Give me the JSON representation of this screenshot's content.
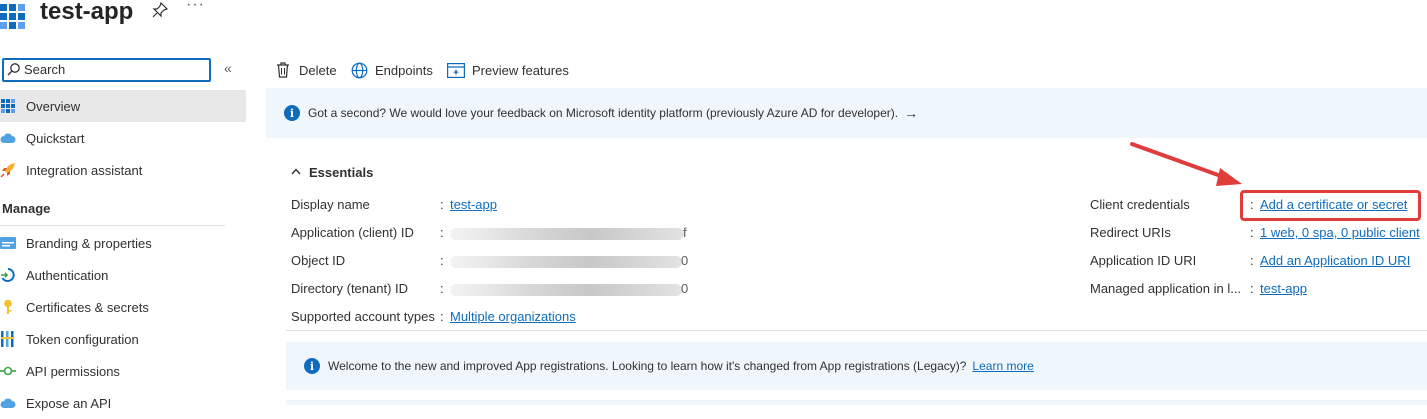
{
  "app": {
    "title": "test-app"
  },
  "sidebar": {
    "search_placeholder": "Search",
    "collapse_glyph": "«",
    "items_top": [
      {
        "label": "Overview",
        "icon": "grid-icon",
        "active": true
      },
      {
        "label": "Quickstart",
        "icon": "cloud-icon"
      },
      {
        "label": "Integration assistant",
        "icon": "rocket-icon"
      }
    ],
    "section_header": "Manage",
    "items_manage": [
      {
        "label": "Branding & properties",
        "icon": "branding-icon"
      },
      {
        "label": "Authentication",
        "icon": "authentication-icon"
      },
      {
        "label": "Certificates & secrets",
        "icon": "key-icon"
      },
      {
        "label": "Token configuration",
        "icon": "token-icon"
      },
      {
        "label": "API permissions",
        "icon": "api-permissions-icon"
      },
      {
        "label": "Expose an API",
        "icon": "cloud-api-icon"
      }
    ]
  },
  "toolbar": {
    "delete_label": "Delete",
    "endpoints_label": "Endpoints",
    "preview_label": "Preview features"
  },
  "feedback_banner": {
    "text": "Got a second? We would love your feedback on Microsoft identity platform (previously Azure AD for developer).",
    "arrow": "→"
  },
  "essentials": {
    "title": "Essentials",
    "left": [
      {
        "label": "Display name",
        "value": "test-app",
        "link": true
      },
      {
        "label": "Application (client) ID",
        "value": "f",
        "redacted": true
      },
      {
        "label": "Object ID",
        "value": "0",
        "redacted": true
      },
      {
        "label": "Directory (tenant) ID",
        "value": "0",
        "redacted": true
      },
      {
        "label": "Supported account types",
        "value": "Multiple organizations",
        "link": true
      }
    ],
    "right": [
      {
        "label": "Client credentials",
        "value": "Add a certificate or secret"
      },
      {
        "label": "Redirect URIs",
        "value": "1 web, 0 spa, 0 public client"
      },
      {
        "label": "Application ID URI",
        "value": "Add an Application ID URI"
      },
      {
        "label": "Managed application in l...",
        "value": "test-app"
      }
    ]
  },
  "welcome_banner": {
    "text": "Welcome to the new and improved App registrations. Looking to learn how it's changed from App registrations (Legacy)?",
    "link": "Learn more"
  },
  "colors": {
    "accent": "#0f6cbd",
    "highlight": "#e03c3c",
    "banner_bg": "#eff6fc"
  }
}
